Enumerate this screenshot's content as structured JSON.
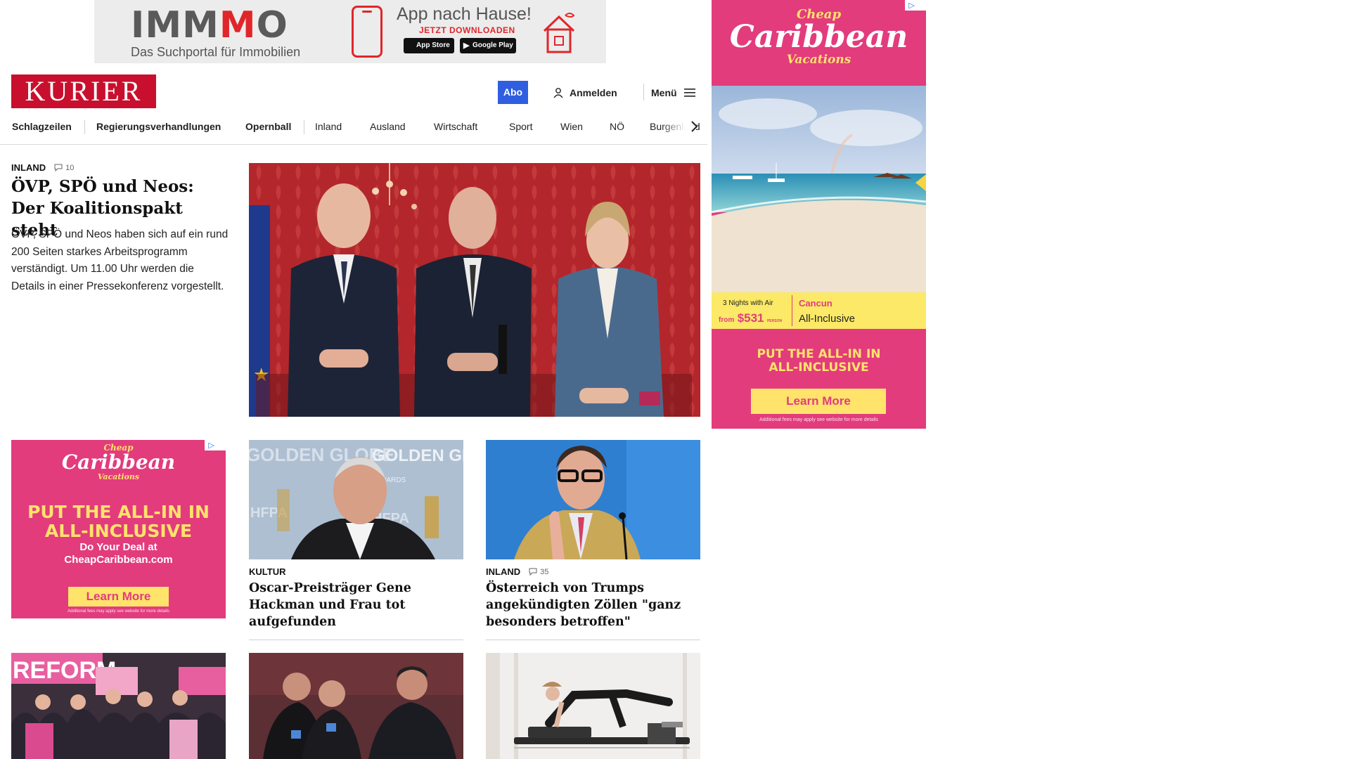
{
  "top_ad": {
    "brand_prefix": "IMM",
    "brand_m": "M",
    "brand_suffix": "O",
    "tagline": "Das Suchportal für Immobilien",
    "app_title": "App nach Hause!",
    "app_sub": "JETZT DOWNLOADEN",
    "app_store": "App Store",
    "google_play": "Google Play"
  },
  "header": {
    "logo": "KURIER",
    "abo": "Abo",
    "login": "Anmelden",
    "menu": "Menü"
  },
  "nav": {
    "items": [
      "Schlagzeilen",
      "Regierungsverhandlungen",
      "Opernball",
      "Inland",
      "Ausland",
      "Wirtschaft",
      "Sport",
      "Wien",
      "NÖ",
      "Burgenland"
    ]
  },
  "lead": {
    "kicker": "INLAND",
    "comments": "10",
    "title": "ÖVP, SPÖ und Neos: Der Koalitionspakt steht",
    "teaser": "ÖVP, SPÖ und Neos haben sich auf ein rund 200 Seiten starkes Arbeitsprogramm verständigt. Um 11.00 Uhr werden die Details in einer Pressekonferenz vorgestellt."
  },
  "cards": [
    {
      "kicker": "KULTUR",
      "title": "Oscar-Preisträger Gene Hackman und Frau tot aufgefunden"
    },
    {
      "kicker": "INLAND",
      "comments": "35",
      "title": "Österreich von Trumps angekündigten Zöllen \"ganz besonders betroffen\""
    }
  ],
  "photo_texts": {
    "golden_globe_1": "GOLDEN GLOBE",
    "golden_globe_2": "AWARDS",
    "hfpa": "HFPA",
    "reform": "REFORM"
  },
  "side_ad": {
    "logo_small": "Cheap",
    "logo_big": "Caribbean",
    "logo_vac": "Vacations",
    "nights": "3 Nights with Air",
    "from": "from",
    "price": "$531",
    "person": "PERSON",
    "destination": "Cancun",
    "package": "All-Inclusive",
    "headline_1": "PUT THE ALL-IN IN",
    "headline_2": "ALL-INCLUSIVE",
    "cta": "Learn More",
    "fine": "Additional fees may apply see website for more details"
  },
  "inline_ad": {
    "logo_small": "Cheap",
    "logo_big": "Caribbean",
    "logo_vac": "Vacations",
    "headline_1": "PUT THE ALL-IN IN",
    "headline_2": "ALL-INCLUSIVE",
    "sub_1": "Do Your Deal at",
    "sub_2": "CheapCaribbean.com",
    "cta": "Learn More",
    "fine": "Additional fees may apply see website for more details"
  },
  "colors": {
    "kurier_red": "#c8102e",
    "abo_blue": "#2f5fe0",
    "ad_pink": "#e23c7d",
    "ad_yellow": "#ffe36b"
  }
}
